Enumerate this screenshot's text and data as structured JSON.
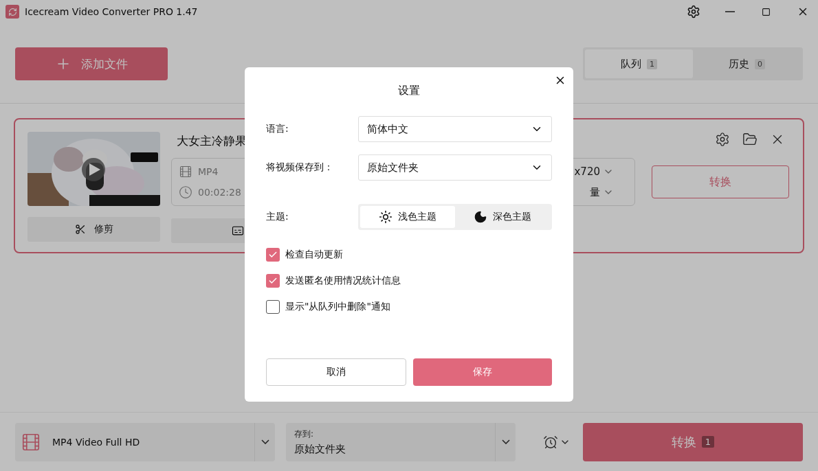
{
  "window": {
    "title": "Icecream Video Converter PRO 1.47"
  },
  "toolbar": {
    "add_button": "添加文件"
  },
  "tabs": [
    {
      "label": "队列",
      "count": "1",
      "selected": true
    },
    {
      "label": "历史",
      "count": "0",
      "selected": false
    }
  ],
  "queue_item": {
    "title": "大女主冷静果",
    "format": "MP4",
    "duration": "00:02:28",
    "resolution": "x720",
    "quality": "量",
    "trim_button": "修剪",
    "convert_button": "转换"
  },
  "bottom_bar": {
    "preset": "MP4 Video Full HD",
    "save_to_label": "存到:",
    "save_to_value": "原始文件夹",
    "convert_label": "转换",
    "convert_count": "1"
  },
  "settings_dialog": {
    "title": "设置",
    "fields": [
      {
        "label": "语言:",
        "value": "简体中文"
      },
      {
        "label": "将视频保存到：",
        "value": "原始文件夹"
      }
    ],
    "theme": {
      "label": "主题:",
      "options": [
        {
          "label": "浅色主题",
          "kind": "light",
          "selected": true
        },
        {
          "label": "深色主题",
          "kind": "dark",
          "selected": false
        }
      ]
    },
    "checkboxes": [
      {
        "label": "检查自动更新",
        "checked": true
      },
      {
        "label": "发送匿名使用情况统计信息",
        "checked": true
      },
      {
        "label": "显示\"从队列中删除\"通知",
        "checked": false
      }
    ],
    "buttons": [
      {
        "label": "取消",
        "kind": "secondary"
      },
      {
        "label": "保存",
        "kind": "primary"
      }
    ]
  }
}
